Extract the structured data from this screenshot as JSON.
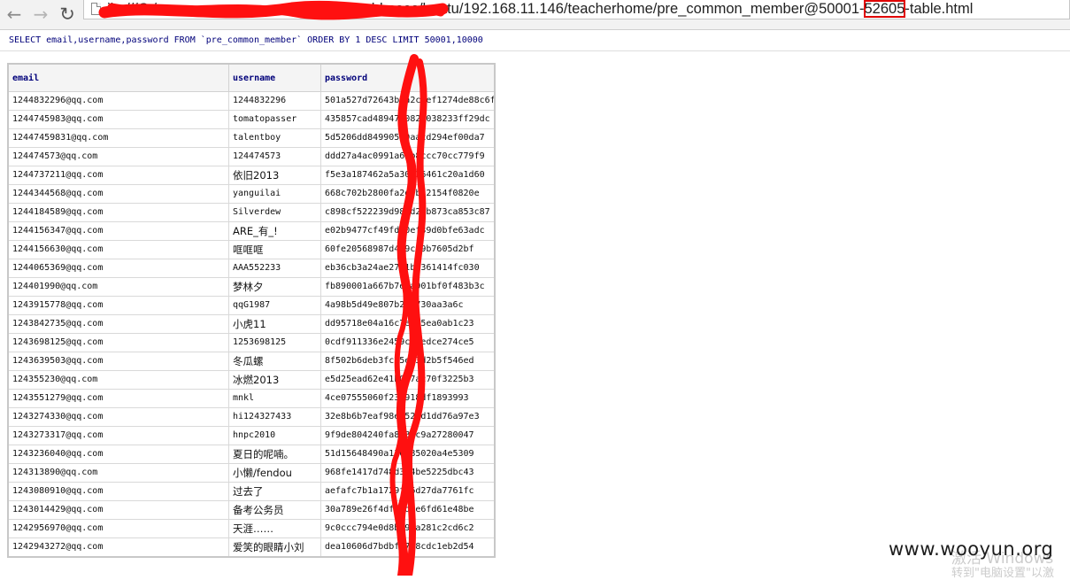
{
  "browser": {
    "back_icon": "arrow-left-icon",
    "forward_icon": "arrow-right-icon",
    "reload_icon": "reload-icon",
    "url_visible_prefix": "ile:///C:/",
    "url_visible_middle": "tchbases/huatu/192.168.11.146/teacherhome/pre_common_member@50001-",
    "url_highlight": "52605",
    "url_visible_suffix": "-table.html"
  },
  "query": {
    "sql": "SELECT email,username,password FROM `pre_common_member` ORDER BY 1 DESC LIMIT 50001,10000"
  },
  "table": {
    "headers": [
      "email",
      "username",
      "password"
    ],
    "rows": [
      [
        "1244832296@qq.com",
        "1244832296",
        "501a527d72643b1a2c8ef1274de88c6f"
      ],
      [
        "1244745983@qq.com",
        "tomatopasser",
        "435857cad48947d082a038233ff29dc"
      ],
      [
        "12447459831@qq.com",
        "talentboy",
        "5d5206dd849905c0aacd294ef00da7"
      ],
      [
        "124474573@qq.com",
        "124474573",
        "ddd27a4ac0991a65b8ccc70cc779f9"
      ],
      [
        "1244737211@qq.com",
        "依旧2013",
        "f5e3a187462a5a30e16461c20a1d60"
      ],
      [
        "1244344568@qq.com",
        "yanguilai",
        "668c702b2800fa2ecbf2154f0820e"
      ],
      [
        "1244184589@qq.com",
        "Silverdew",
        "c898cf522239d98dd2db873ca853c87"
      ],
      [
        "1244156347@qq.com",
        "ARE_有_!",
        "e02b9477cf49fdd0ef39d0bfe63adc"
      ],
      [
        "1244156630@qq.com",
        "哐哐哐",
        "60fe20568987d4f9c49b7605d2bf"
      ],
      [
        "1244065369@qq.com",
        "AAA552233",
        "eb36cb3a24ae2781b2361414fc030"
      ],
      [
        "124401990@qq.com",
        "梦林夕",
        "fb890001a667b7e9a901bf0f483b3c"
      ],
      [
        "1243915778@qq.com",
        "qqG1987",
        "4a98b5d49e807b260730aa3a6c"
      ],
      [
        "1243842735@qq.com",
        "小虎11",
        "dd95718e04a16c7e385ea0ab1c23"
      ],
      [
        "1243698125@qq.com",
        "1253698125",
        "0cdf911336e2459cf3edce274ce5"
      ],
      [
        "1243639503@qq.com",
        "冬瓜螺",
        "8f502b6deb3fc75e23d2b5f546ed"
      ],
      [
        "124355230@qq.com",
        "冰燃2013",
        "e5d25ead62e41b087ac70f3225b3"
      ],
      [
        "1243551279@qq.com",
        "mnkl",
        "4ce07555060f23e918df1893993"
      ],
      [
        "1243274330@qq.com",
        "hi124327433",
        "32e8b6b7eaf98e652ad1dd76a97e3"
      ],
      [
        "1243273317@qq.com",
        "hnpc2010",
        "9f9de804240fa848bc9a27280047"
      ],
      [
        "1243236040@qq.com",
        "夏日的呢喃。",
        "51d15648490a136185020a4e5309"
      ],
      [
        "124313890@qq.com",
        "小懒/fendou",
        "968fe1417d748d344be5225dbc43"
      ],
      [
        "1243080910@qq.com",
        "过去了",
        "aefafc7b1a1729f06d27da7761fc"
      ],
      [
        "1243014429@qq.com",
        "备考公务员",
        "30a789e26f4dff5d5e6fd61e48be"
      ],
      [
        "1242956970@qq.com",
        "天涯……",
        "9c0ccc794e0d8b79ea281c2cd6c2"
      ],
      [
        "1242943272@qq.com",
        "爱笑的眼睛小刘",
        "dea10606d7bdbf8758cdc1eb2d54"
      ]
    ]
  },
  "watermark": {
    "brand": "www.wooyun.org",
    "ghost_line1": "激活 Windows",
    "ghost_line2": "转到\"电脑设置\"以激"
  },
  "colors": {
    "redaction": "#ff1010",
    "sql_text": "#00007a",
    "header_text": "#00007a",
    "url_highlight_box": "#e00000"
  }
}
